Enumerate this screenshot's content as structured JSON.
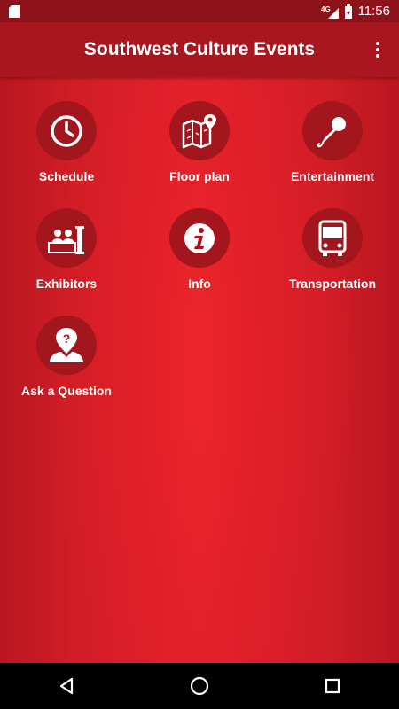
{
  "status_bar": {
    "network": "4G",
    "time": "11:56"
  },
  "app_bar": {
    "title": "Southwest Culture Events"
  },
  "menu": [
    {
      "label": "Schedule",
      "icon": "clock-icon"
    },
    {
      "label": "Floor plan",
      "icon": "map-pin-icon"
    },
    {
      "label": "Entertainment",
      "icon": "microphone-icon"
    },
    {
      "label": "Exhibitors",
      "icon": "exhibitor-booth-icon"
    },
    {
      "label": "Info",
      "icon": "info-icon"
    },
    {
      "label": "Transportation",
      "icon": "bus-icon"
    },
    {
      "label": "Ask a Question",
      "icon": "question-person-icon"
    }
  ],
  "colors": {
    "status_bar": "#8e1219",
    "app_bar": "#a9161f",
    "background": "#dc1f29",
    "icon_circle": "#a3161e",
    "nav_bar": "#000000"
  }
}
